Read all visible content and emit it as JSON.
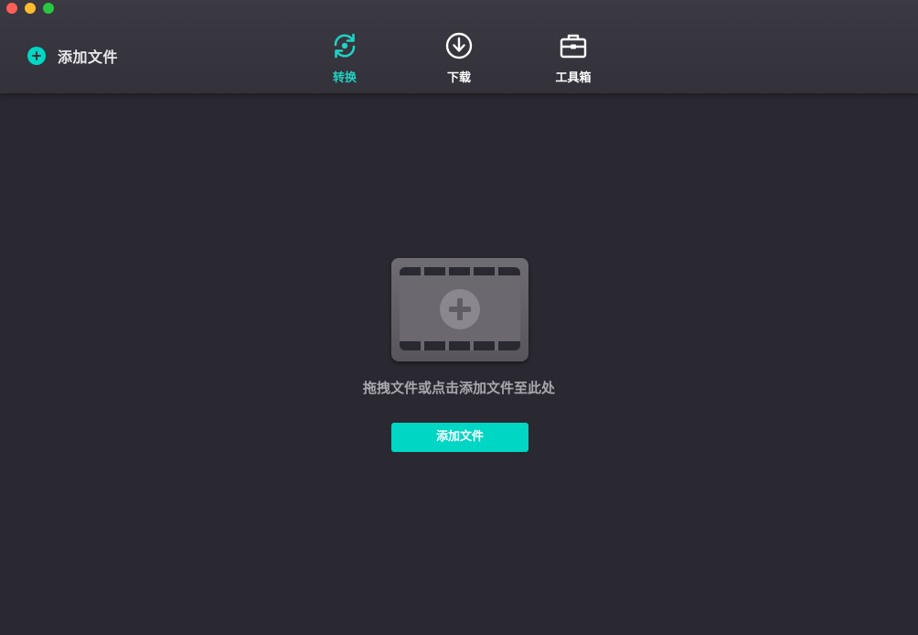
{
  "window": {
    "controls": [
      "close",
      "minimize",
      "zoom"
    ]
  },
  "toolbar": {
    "add_file_label": "添加文件",
    "tabs": [
      {
        "label": "转换",
        "icon": "convert-icon",
        "active": true
      },
      {
        "label": "下载",
        "icon": "download-icon",
        "active": false
      },
      {
        "label": "工具箱",
        "icon": "toolbox-icon",
        "active": false
      }
    ]
  },
  "drop_zone": {
    "icon": "film-add-icon",
    "hint": "拖拽文件或点击添加文件至此处",
    "button_label": "添加文件"
  },
  "colors": {
    "accent": "#00d6c4",
    "background": "#2a2830",
    "toolbar": "#37353d"
  }
}
